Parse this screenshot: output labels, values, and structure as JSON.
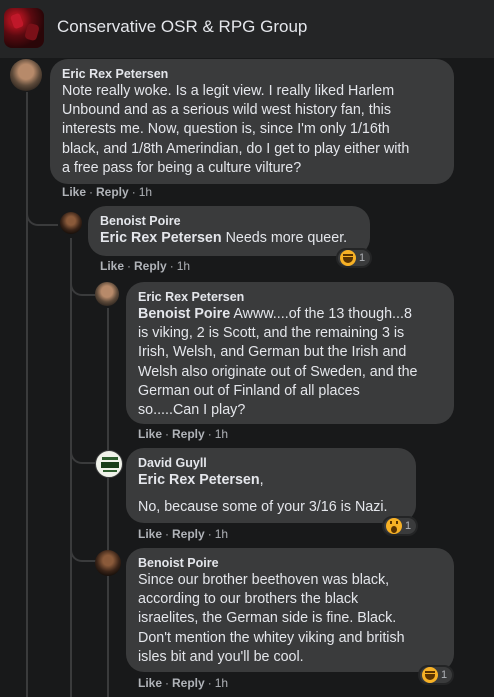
{
  "group": {
    "title": "Conservative OSR & RPG Group"
  },
  "actions": {
    "like": "Like",
    "reply": "Reply",
    "sep": "·"
  },
  "comments": [
    {
      "author": "Eric Rex Petersen",
      "text": "Note really woke. Is a legit view. I really liked Harlem\nUnbound and as a serious wild west history fan, this\ninterests me. Now, question is, since I'm only 1/16th\nblack, and 1/8th Amerindian, do I get to play either with\na free pass for being a culture vilture?",
      "time": "1h"
    },
    {
      "author": "Benoist Poire",
      "tag": "Eric Rex Petersen",
      "text": " Needs more queer.",
      "time": "1h",
      "reaction": {
        "icon": "haha-emoji",
        "count": "1"
      }
    },
    {
      "author": "Eric Rex Petersen",
      "tag": "Benoist Poire",
      "text": " Awww....of the 13 though...8\nis viking, 2 is Scott, and the remaining 3 is\nIrish, Welsh, and German but the Irish and\nWelsh also originate out of Sweden, and the\nGerman out of Finland of all places\nso.....Can I play?",
      "time": "1h"
    },
    {
      "author": "David Guyll",
      "tag": "Eric Rex Petersen",
      "tag_suffix": ",",
      "text": "No, because some of your 3/16 is Nazi.",
      "time": "1h",
      "reaction": {
        "icon": "wow-emoji",
        "count": "1"
      }
    },
    {
      "author": "Benoist Poire",
      "text": "Since our brother beethoven was black,\naccording to our brothers the black\nisraelites, the German side is fine. Black.\nDon't mention the whitey viking and british\nisles bit and you'll be cool.",
      "time": "1h",
      "reaction": {
        "icon": "haha-emoji",
        "count": "1"
      }
    }
  ]
}
